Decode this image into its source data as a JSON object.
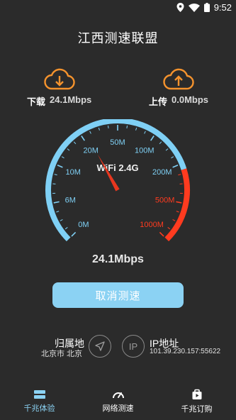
{
  "status_bar": {
    "time": "9:52"
  },
  "app": {
    "title": "江西测速联盟"
  },
  "download": {
    "label": "下载",
    "value": "24.1Mbps"
  },
  "upload": {
    "label": "上传",
    "value": "0.0Mbps"
  },
  "gauge": {
    "network": "WiFi 2.4G",
    "ticks": [
      "0M",
      "6M",
      "10M",
      "20M",
      "50M",
      "100M",
      "200M",
      "500M",
      "1000M"
    ],
    "current_speed_mbps": 24.1
  },
  "result": {
    "speed": "24.1Mbps"
  },
  "cancel_button": "取消测速",
  "location": {
    "title": "归属地",
    "value": "北京市 北京"
  },
  "ip": {
    "title": "IP地址",
    "value": "101.39.230.157:55622",
    "badge": "IP"
  },
  "nav": [
    {
      "label": "千兆体验"
    },
    {
      "label": "网络测速"
    },
    {
      "label": "千兆订购"
    }
  ],
  "colors": {
    "accent": "#8bd2f3",
    "arc_blue": "#7fd0f5",
    "arc_red": "#ff3b1f",
    "needle": "#e8371f",
    "orange": "#f5932d",
    "background": "#2b2b2b"
  }
}
